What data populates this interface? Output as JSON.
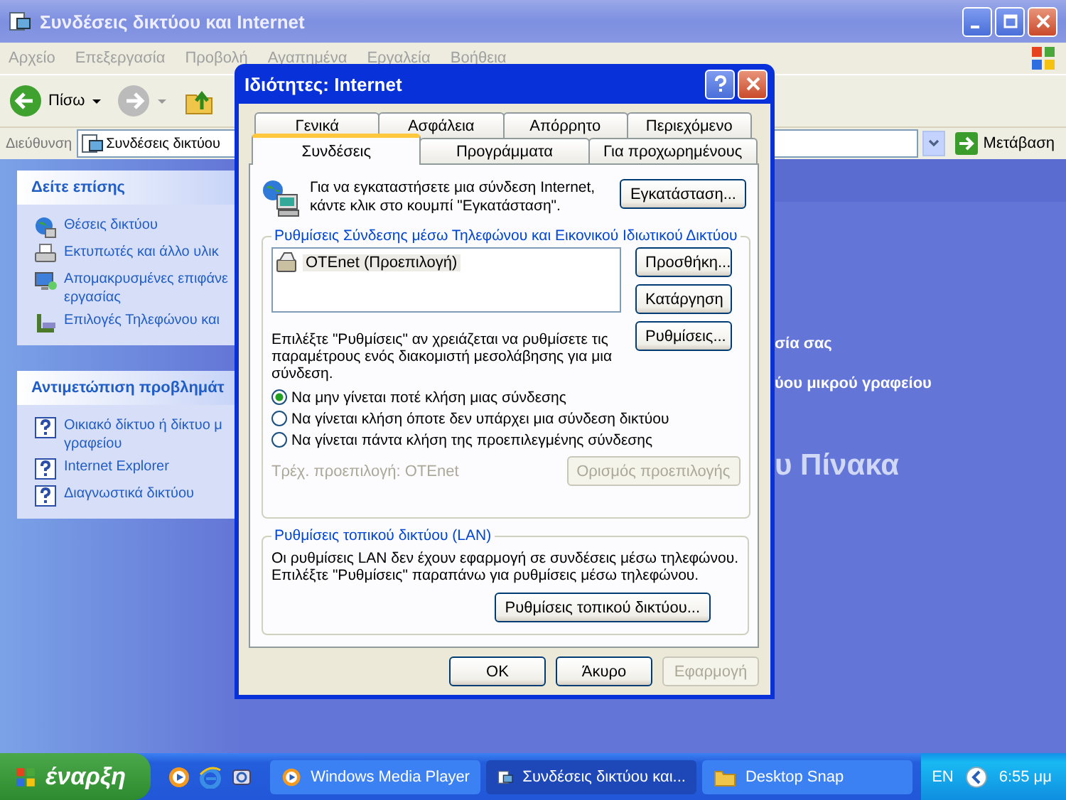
{
  "window": {
    "title": "Συνδέσεις δικτύου και Internet"
  },
  "menu": [
    "Αρχείο",
    "Επεξεργασία",
    "Προβολή",
    "Αγαπημένα",
    "Εργαλεία",
    "Βοήθεια"
  ],
  "toolbar": {
    "back": "Πίσω"
  },
  "address": {
    "label": "Διεύθυνση",
    "value": "Συνδέσεις δικτύου",
    "go": "Μετάβαση"
  },
  "sidebar": [
    {
      "title": "Δείτε επίσης",
      "items": [
        {
          "label": "Θέσεις δικτύου"
        },
        {
          "label": "Εκτυπωτές και άλλο υλικ"
        },
        {
          "label": "Απομακρυσμένες επιφάνε",
          "label2": "εργασίας"
        },
        {
          "label": "Επιλογές Τηλεφώνου και"
        }
      ]
    },
    {
      "title": "Αντιμετώπιση προβλημάτ",
      "items": [
        {
          "label": "Οικιακό δίκτυο ή δίκτυο μ",
          "label2": "γραφείου"
        },
        {
          "label": "Internet Explorer"
        },
        {
          "label": "Διαγνωστικά δικτύου"
        }
      ]
    }
  ],
  "main_texts": [
    "σία σας",
    "ύου μικρού γραφείου"
  ],
  "main_heading": "υ Πίνακα",
  "dialog": {
    "title": "Ιδιότητες: Internet",
    "tab_rows": [
      [
        {
          "label": "Γενικά",
          "selected": false
        },
        {
          "label": "Ασφάλεια",
          "selected": false
        },
        {
          "label": "Απόρρητο",
          "selected": false
        },
        {
          "label": "Περιεχόμενο",
          "selected": false
        }
      ],
      [
        {
          "label": "Συνδέσεις",
          "selected": true
        },
        {
          "label": "Προγράμματα",
          "selected": false
        },
        {
          "label": "Για προχωρημένους",
          "selected": false
        }
      ]
    ],
    "setup_text": [
      "Για να εγκαταστήσετε μια σύνδεση Internet,",
      "κάντε κλικ στο κουμπί \"Εγκατάσταση\"."
    ],
    "setup_button": "Εγκατάσταση...",
    "dialup": {
      "title": "Ρυθμίσεις Σύνδεσης μέσω Τηλεφώνου και Εικονικού Ιδιωτικού Δικτύου",
      "connections": [
        {
          "label": "OTEnet (Προεπιλογή)",
          "selected": true
        }
      ],
      "buttons": [
        "Προσθήκη...",
        "Κατάργηση",
        "Ρυθμίσεις..."
      ],
      "hint": "Επιλέξτε \"Ρυθμίσεις\" αν χρειάζεται να ρυθμίσετε τις παραμέτρους ενός διακομιστή μεσολάβησης για μια σύνδεση.",
      "options": [
        {
          "label": "Να μην γίνεται ποτέ κλήση μιας σύνδεσης",
          "selected": true
        },
        {
          "label": "Να γίνεται κλήση όποτε δεν υπάρχει μια σύνδεση δικτύου",
          "selected": false
        },
        {
          "label": "Να γίνεται πάντα κλήση της προεπιλεγμένης σύνδεσης",
          "selected": false
        }
      ],
      "current_label": "Τρέχ. προεπιλογή:",
      "current_value": "OTEnet",
      "current_disabled": true,
      "set_default": {
        "label": "Ορισμός προεπιλογής",
        "disabled": true
      }
    },
    "lan": {
      "title": "Ρυθμίσεις τοπικού δικτύου (LAN)",
      "text": [
        "Οι ρυθμίσεις LAN δεν έχουν εφαρμογή σε συνδέσεις μέσω τηλεφώνου.",
        "Επιλέξτε \"Ρυθμίσεις\" παραπάνω για ρυθμίσεις μέσω τηλεφώνου."
      ],
      "button": "Ρυθμίσεις τοπικού δικτύου..."
    },
    "footer": [
      {
        "label": "OK",
        "disabled": false
      },
      {
        "label": "Άκυρο",
        "disabled": false
      },
      {
        "label": "Εφαρμογή",
        "disabled": true
      }
    ]
  },
  "taskbar": {
    "start": "έναρξη",
    "tasks": [
      {
        "label": "Windows Media Player",
        "selected": false
      },
      {
        "label": "Συνδέσεις δικτύου και...",
        "selected": true
      },
      {
        "label": "Desktop Snap",
        "selected": false
      }
    ],
    "language": "EN",
    "clock": "6:55 μμ"
  }
}
